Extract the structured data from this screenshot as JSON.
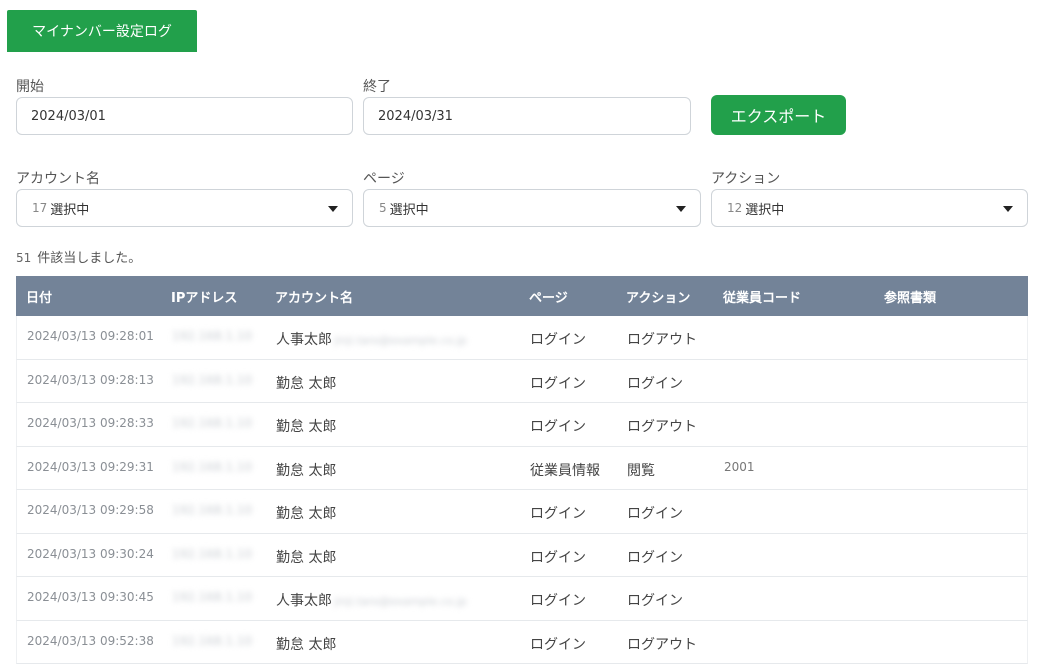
{
  "tab": {
    "label": "マイナンバー設定ログ"
  },
  "filters": {
    "start_label": "開始",
    "start_value": "2024/03/01",
    "end_label": "終了",
    "end_value": "2024/03/31",
    "export_label": "エクスポート",
    "account_label": "アカウント名",
    "account_count": "17",
    "account_value": "選択中",
    "page_label": "ページ",
    "page_count": "5",
    "page_value": "選択中",
    "action_label": "アクション",
    "action_count": "12",
    "action_value": "選択中"
  },
  "result": {
    "count": "51",
    "text": "件該当しました。"
  },
  "table": {
    "headers": [
      "日付",
      "IPアドレス",
      "アカウント名",
      "ページ",
      "アクション",
      "従業員コード",
      "参照書類"
    ],
    "rows": [
      {
        "date": "2024/03/13 09:28:01",
        "ip": "192.168.1.10",
        "account": "人事太郎",
        "email": "jinji.taro@example.co.jp",
        "page": "ログイン",
        "action": "ログアウト",
        "code": ""
      },
      {
        "date": "2024/03/13 09:28:13",
        "ip": "192.168.1.10",
        "account": "勤怠 太郎",
        "email": "",
        "page": "ログイン",
        "action": "ログイン",
        "code": ""
      },
      {
        "date": "2024/03/13 09:28:33",
        "ip": "192.168.1.10",
        "account": "勤怠 太郎",
        "email": "",
        "page": "ログイン",
        "action": "ログアウト",
        "code": ""
      },
      {
        "date": "2024/03/13 09:29:31",
        "ip": "192.168.1.10",
        "account": "勤怠 太郎",
        "email": "",
        "page": "従業員情報",
        "action": "閲覧",
        "code": "2001"
      },
      {
        "date": "2024/03/13 09:29:58",
        "ip": "192.168.1.10",
        "account": "勤怠 太郎",
        "email": "",
        "page": "ログイン",
        "action": "ログイン",
        "code": ""
      },
      {
        "date": "2024/03/13 09:30:24",
        "ip": "192.168.1.10",
        "account": "勤怠 太郎",
        "email": "",
        "page": "ログイン",
        "action": "ログイン",
        "code": ""
      },
      {
        "date": "2024/03/13 09:30:45",
        "ip": "192.168.1.10",
        "account": "人事太郎",
        "email": "jinji.taro@example.co.jp",
        "page": "ログイン",
        "action": "ログイン",
        "code": ""
      },
      {
        "date": "2024/03/13 09:52:38",
        "ip": "192.168.1.10",
        "account": "勤怠 太郎",
        "email": "",
        "page": "ログイン",
        "action": "ログアウト",
        "code": ""
      }
    ]
  }
}
